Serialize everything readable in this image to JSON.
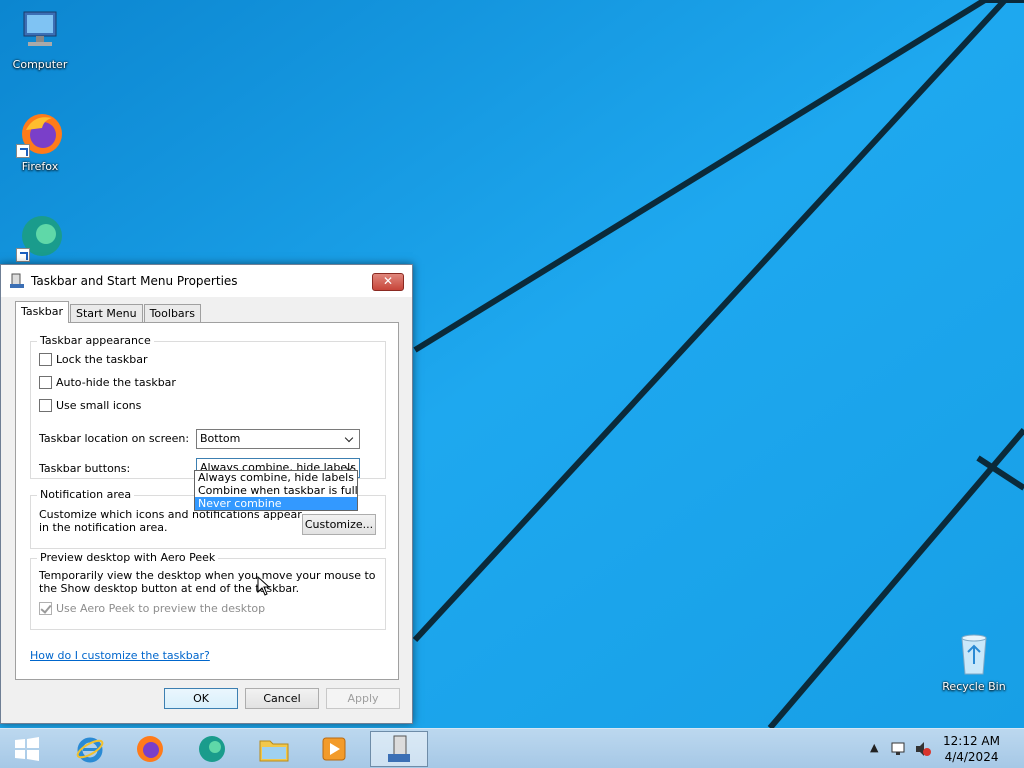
{
  "desktop": {
    "icons": [
      {
        "label": "Computer"
      },
      {
        "label": "Firefox"
      },
      {
        "label": "Recycle Bin"
      }
    ]
  },
  "dialog": {
    "title": "Taskbar and Start Menu Properties",
    "close_label": "✕",
    "tabs": [
      {
        "label": "Taskbar",
        "active": true
      },
      {
        "label": "Start Menu",
        "active": false
      },
      {
        "label": "Toolbars",
        "active": false
      }
    ],
    "appearance": {
      "title": "Taskbar appearance",
      "lock": {
        "label": "Lock the taskbar",
        "checked": false
      },
      "autohide": {
        "label": "Auto-hide the taskbar",
        "checked": false
      },
      "small_icons": {
        "label": "Use small icons",
        "checked": false
      },
      "location_label": "Taskbar location on screen:",
      "location_value": "Bottom",
      "buttons_label": "Taskbar buttons:",
      "buttons_value": "Always combine, hide labels",
      "buttons_options": [
        {
          "label": "Always combine, hide labels",
          "selected": false
        },
        {
          "label": "Combine when taskbar is full",
          "selected": false
        },
        {
          "label": "Never combine",
          "selected": true
        }
      ]
    },
    "notification": {
      "title": "Notification area",
      "text1": "Customize which icons and notifications appear",
      "text2": "in the notification area.",
      "customize_label": "Customize..."
    },
    "aero": {
      "title": "Preview desktop with Aero Peek",
      "text1": "Temporarily view the desktop when you move your mouse to",
      "text2": "the Show desktop button at end of the taskbar.",
      "use_label": "Use Aero Peek to preview the desktop",
      "use_checked": true
    },
    "help_link": "How do I customize the taskbar?",
    "ok_label": "OK",
    "cancel_label": "Cancel",
    "apply_label": "Apply"
  },
  "taskbar": {
    "clock_time": "12:12 AM",
    "clock_date": "4/4/2024",
    "tray_arrow": "▲"
  },
  "colors": {
    "desktop": "#1aa4ec",
    "selection": "#3399ff",
    "link": "#0066cc"
  }
}
